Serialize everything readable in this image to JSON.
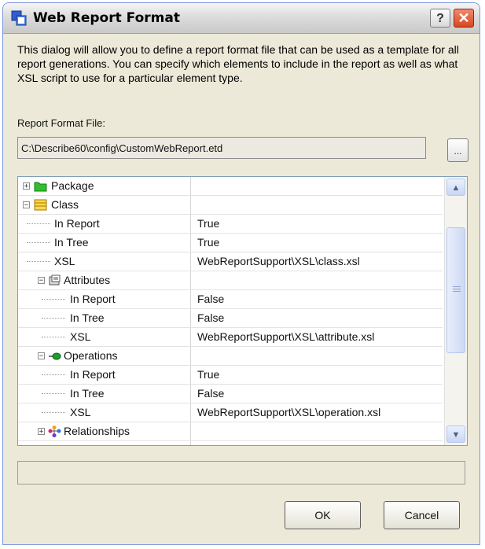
{
  "window": {
    "title": "Web Report Format",
    "help_label": "?",
    "close_label": "✕"
  },
  "description": "This dialog will allow you to define a report format file that can be used as a template for all report generations.  You can specify which elements to include in the report as well as what XSL script to use for a particular element type.",
  "report_file": {
    "label": "Report Format File:",
    "value": "C:\\Describe60\\config\\CustomWebReport.etd",
    "browse_label": "..."
  },
  "tree": {
    "rows": [
      {
        "name": "Package",
        "value": "",
        "icon": "folder-icon",
        "expander": "+"
      },
      {
        "name": "Class",
        "value": "",
        "icon": "class-icon",
        "expander": "−"
      },
      {
        "name": "In Report",
        "value": "True"
      },
      {
        "name": "In Tree",
        "value": "True"
      },
      {
        "name": "XSL",
        "value": "WebReportSupport\\XSL\\class.xsl"
      },
      {
        "name": "Attributes",
        "value": "",
        "icon": "attributes-icon",
        "expander": "−"
      },
      {
        "name": "In Report",
        "value": "False"
      },
      {
        "name": "In Tree",
        "value": "False"
      },
      {
        "name": "XSL",
        "value": "WebReportSupport\\XSL\\attribute.xsl"
      },
      {
        "name": "Operations",
        "value": "",
        "icon": "operations-icon",
        "expander": "−"
      },
      {
        "name": "In Report",
        "value": "True"
      },
      {
        "name": "In Tree",
        "value": "False"
      },
      {
        "name": "XSL",
        "value": "WebReportSupport\\XSL\\operation.xsl"
      },
      {
        "name": "Relationships",
        "value": "",
        "icon": "relationships-icon",
        "expander": "+"
      }
    ],
    "scroll_up": "▲",
    "scroll_down": "▼"
  },
  "status": "",
  "buttons": {
    "ok": "OK",
    "cancel": "Cancel"
  }
}
